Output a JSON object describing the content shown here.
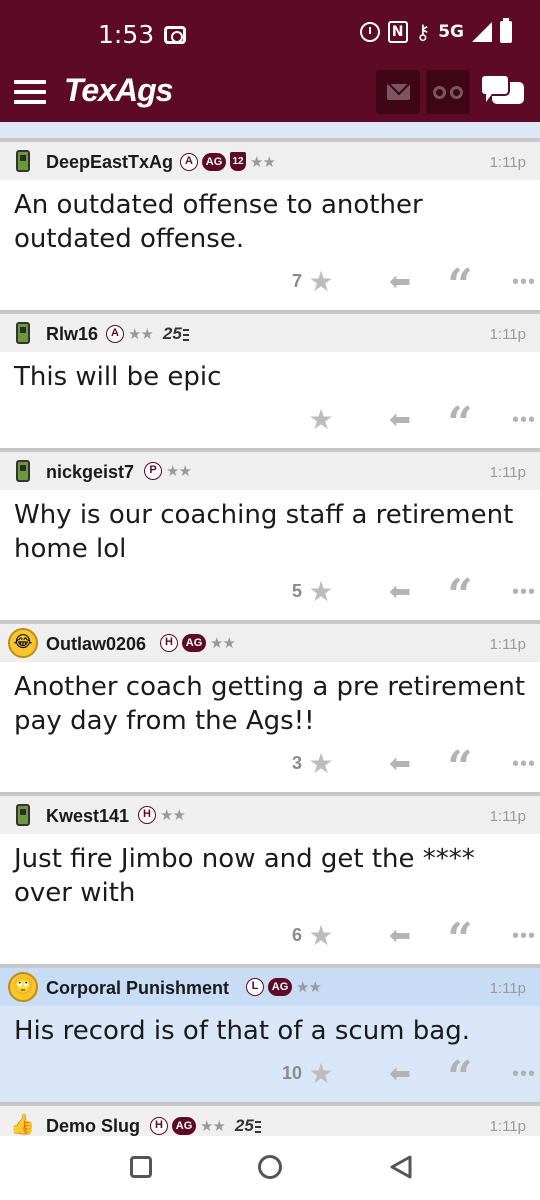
{
  "status_bar": {
    "time": "1:53",
    "network": "5G"
  },
  "app_bar": {
    "logo": "TexAgs"
  },
  "posts": [
    {
      "username": "DeepEastTxAg",
      "avatar": "phone",
      "badges": [
        "A",
        "AG",
        "12",
        "★★"
      ],
      "time": "1:11p",
      "text": "An outdated offense to another outdated offense.",
      "star_count": "7",
      "highlight": false
    },
    {
      "username": "Rlw16",
      "avatar": "phone",
      "badges": [
        "A",
        "★★",
        "25"
      ],
      "time": "1:11p",
      "text": "This will be epic",
      "star_count": "",
      "highlight": false
    },
    {
      "username": "nickgeist7",
      "avatar": "phone",
      "badges": [
        "P",
        "★★"
      ],
      "time": "1:11p",
      "text": "Why is our coaching staff a retirement home lol",
      "star_count": "5",
      "highlight": false
    },
    {
      "username": "Outlaw0206",
      "avatar": "laughing-emoji",
      "badges": [
        "H",
        "AG",
        "★★"
      ],
      "time": "1:11p",
      "text": "Another coach getting a pre retirement pay day from the Ags!!",
      "star_count": "3",
      "highlight": false
    },
    {
      "username": "Kwest141",
      "avatar": "phone",
      "badges": [
        "H",
        "★★"
      ],
      "time": "1:11p",
      "text": "Just fire Jimbo now and get the **** over with",
      "star_count": "6",
      "highlight": false
    },
    {
      "username": "Corporal Punishment",
      "avatar": "rolling-eyes-emoji",
      "badges": [
        "L",
        "AG",
        "★★"
      ],
      "time": "1:11p",
      "text": "His record is of that of a scum bag.",
      "star_count": "10",
      "highlight": true
    },
    {
      "username": "Demo Slug",
      "avatar": "thumbs-hand",
      "badges": [
        "H",
        "AG",
        "★★",
        "25"
      ],
      "time": "1:11p",
      "text": "",
      "star_count": "",
      "highlight": false
    }
  ],
  "icons": {
    "menu": "hamburger-icon",
    "mail": "mail-icon",
    "watch": "binoculars-icon",
    "chat": "chat-bubbles-icon",
    "star": "star-icon",
    "reply": "reply-arrow-icon",
    "quote": "quote-icon",
    "more": "more-dots-icon"
  },
  "colors": {
    "brand": "#5c0a25",
    "highlight": "#d8e6f8"
  }
}
